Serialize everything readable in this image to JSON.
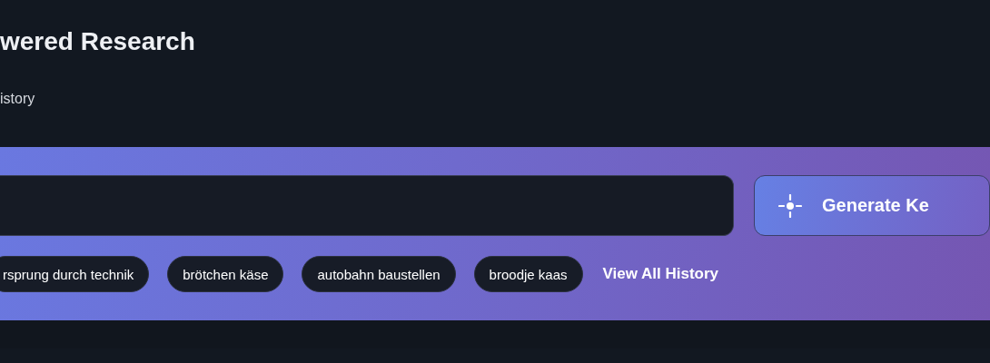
{
  "header": {
    "title": "wered Research",
    "subtitle": "istory"
  },
  "search": {
    "button": "Generate Ke"
  },
  "history": {
    "chips": [
      "rsprung durch technik",
      "brötchen käse",
      "autobahn baustellen",
      "broodje kaas"
    ],
    "link": "View All History"
  }
}
